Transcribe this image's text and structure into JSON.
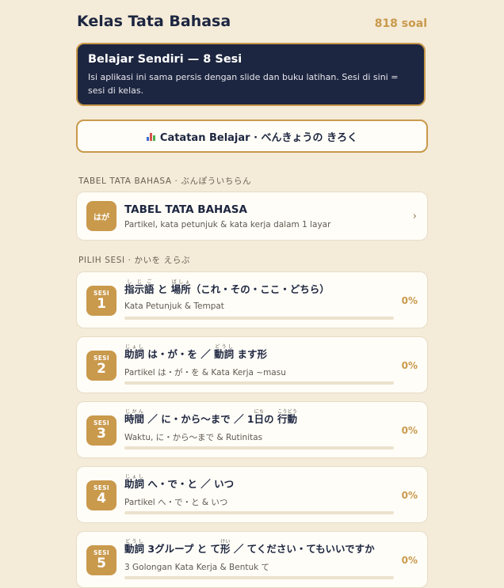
{
  "header": {
    "title": "Kelas Tata Bahasa",
    "count": "818 soal"
  },
  "banner": {
    "title": "Belajar Sendiri — 8 Sesi",
    "desc": "Isi aplikasi ini sama persis dengan slide dan buku latihan. Sesi di sini = sesi di kelas."
  },
  "catatan_button": {
    "label": "Catatan Belajar · べんきょうの きろく",
    "icon": "bar-chart-icon"
  },
  "table_section": {
    "label": "TABEL TATA BAHASA · ぶんぽういちらん",
    "card": {
      "badge": "はが",
      "title": "TABEL TATA BAHASA",
      "subtitle": "Partikel, kata petunjuk & kata kerja dalam 1 layar",
      "icon": "chevron-right-icon"
    }
  },
  "sessions_section": {
    "label": "PILIH SESI · かいを えらぶ",
    "badge_prefix": "SESI",
    "items": [
      {
        "number": "1",
        "title_segments": [
          {
            "t": "指示語",
            "r": "しじご"
          },
          {
            "t": " と "
          },
          {
            "t": "場所",
            "r": "ばしょ"
          },
          {
            "t": "（これ・その・ここ・どちら）"
          }
        ],
        "subtitle": "Kata Petunjuk & Tempat",
        "progress": 0,
        "percent": "0%"
      },
      {
        "number": "2",
        "title_segments": [
          {
            "t": "助詞",
            "r": "じょし"
          },
          {
            "t": " は・が・を ／ "
          },
          {
            "t": "動詞",
            "r": "どうし"
          },
          {
            "t": " ます形"
          }
        ],
        "subtitle": "Partikel は・が・を & Kata Kerja ~masu",
        "progress": 0,
        "percent": "0%"
      },
      {
        "number": "3",
        "title_segments": [
          {
            "t": "時間",
            "r": "じかん"
          },
          {
            "t": " ／ に・から〜まで ／ 1"
          },
          {
            "t": "日",
            "r": "にち"
          },
          {
            "t": "の "
          },
          {
            "t": "行動",
            "r": "こうどう"
          }
        ],
        "subtitle": "Waktu, に・から〜まで & Rutinitas",
        "progress": 0,
        "percent": "0%"
      },
      {
        "number": "4",
        "title_segments": [
          {
            "t": "助詞",
            "r": "じょし"
          },
          {
            "t": " へ・で・と ／ いつ"
          }
        ],
        "subtitle": "Partikel へ・で・と & いつ",
        "progress": 0,
        "percent": "0%"
      },
      {
        "number": "5",
        "title_segments": [
          {
            "t": "動詞",
            "r": "どうし"
          },
          {
            "t": " 3グループ と て"
          },
          {
            "t": "形",
            "r": "けい"
          },
          {
            "t": " ／ てください・てもいいですか"
          }
        ],
        "subtitle": "3 Golongan Kata Kerja & Bentuk て",
        "progress": 0,
        "percent": "0%"
      }
    ]
  },
  "colors": {
    "navy": "#1d2640",
    "gold": "#c9994c",
    "background": "#f4ebd9",
    "card": "#fffdf7"
  }
}
